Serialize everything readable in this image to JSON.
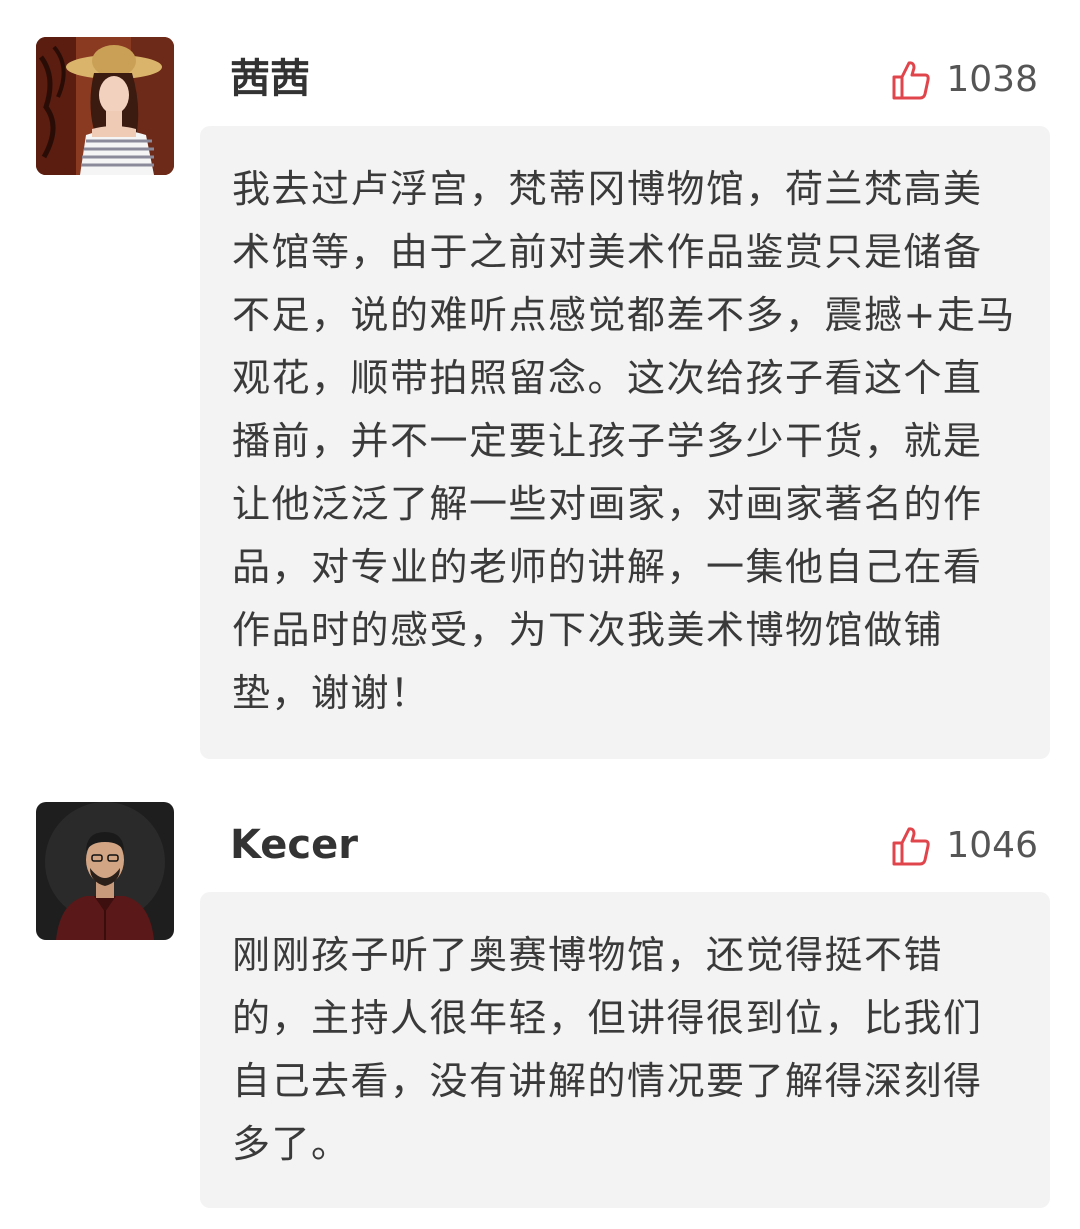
{
  "comments": [
    {
      "username": "茜茜",
      "likes": "1038",
      "avatar_icon": "woman-with-straw-hat-avatar",
      "text": "我去过卢浮宫，梵蒂冈博物馆，荷兰梵高美术馆等，由于之前对美术作品鉴赏只是储备不足，说的难听点感觉都差不多，震撼+走马观花，顺带拍照留念。这次给孩子看这个直播前，并不一定要让孩子学多少干货，就是让他泛泛了解一些对画家，对画家著名的作品，对专业的老师的讲解，一集他自己在看作品时的感受，为下次我美术博物馆做铺垫，谢谢！"
    },
    {
      "username": "Kecer",
      "likes": "1046",
      "avatar_icon": "man-dark-shirt-avatar",
      "text": "刚刚孩子听了奥赛博物馆，还觉得挺不错的，主持人很年轻，但讲得很到位，比我们自己去看，没有讲解的情况要了解得深刻得多了。"
    }
  ],
  "colors": {
    "like_icon": "#e0454c",
    "bubble_bg": "#f3f3f3",
    "username": "#333333",
    "text": "#3a3a3a"
  }
}
